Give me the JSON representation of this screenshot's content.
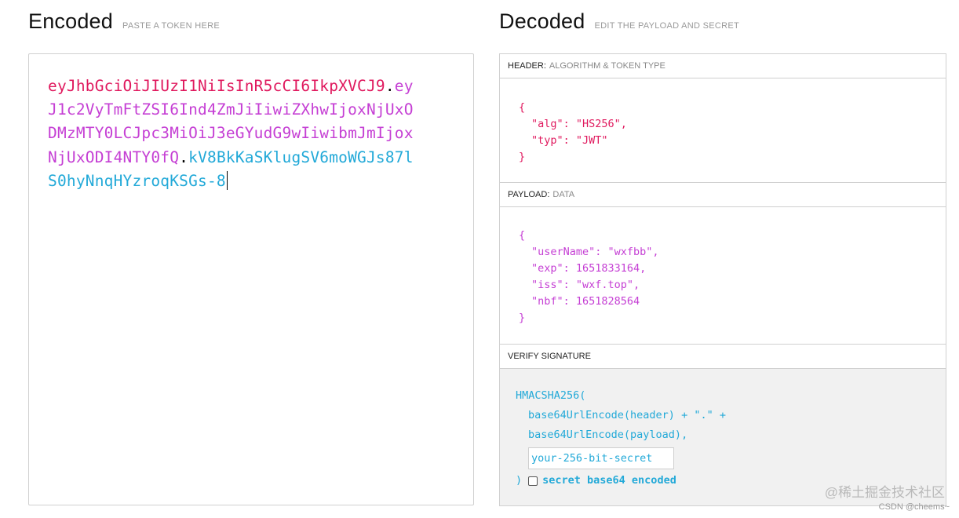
{
  "encoded": {
    "title": "Encoded",
    "subtitle": "PASTE A TOKEN HERE",
    "token": {
      "header": "eyJhbGciOiJIUzI1NiIsInR5cCI6IkpXVCJ9",
      "dot1": ".",
      "payload": "eyJ1c2VyTmFtZSI6Ind4ZmJiIiwiZXhwIjoxNjUxODMzMTY0LCJpc3MiOiJ3eGYudG9wIiwibmJmIjoxNjUxODI4NTY0fQ",
      "dot2": ".",
      "signature": "kV8BkKaSKlugSV6moWGJs87lS0hyNnqHYzroqKSGs-8"
    }
  },
  "decoded": {
    "title": "Decoded",
    "subtitle": "EDIT THE PAYLOAD AND SECRET",
    "header_section": {
      "label": "HEADER:",
      "sub": "ALGORITHM & TOKEN TYPE",
      "lines": [
        "{",
        "\"alg\": \"HS256\",",
        "\"typ\": \"JWT\"",
        "}"
      ]
    },
    "payload_section": {
      "label": "PAYLOAD:",
      "sub": "DATA",
      "lines": [
        "{",
        "\"userName\": \"wxfbb\",",
        "\"exp\": 1651833164,",
        "\"iss\": \"wxf.top\",",
        "\"nbf\": 1651828564",
        "}"
      ]
    },
    "verify_section": {
      "label": "VERIFY SIGNATURE",
      "fn": "HMACSHA256(",
      "line1": "base64UrlEncode(header) + \".\" +",
      "line2": "base64UrlEncode(payload),",
      "secret_placeholder": "your-256-bit-secret",
      "close": ")",
      "b64_label": "secret base64 encoded"
    }
  },
  "watermark": "@稀土掘金技术社区",
  "csdn_label": "CSDN @cheems~",
  "colors": {
    "header": "#e0195e",
    "payload": "#c53fd4",
    "signature": "#22a9d8"
  }
}
